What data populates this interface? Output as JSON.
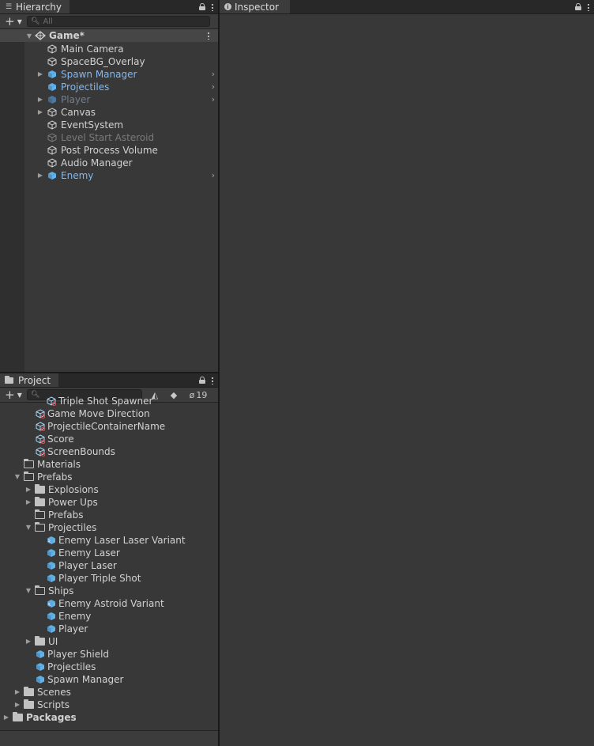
{
  "hierarchy": {
    "tab_label": "Hierarchy",
    "search_placeholder": "All",
    "scene_name": "Game*",
    "items": [
      {
        "label": "Main Camera",
        "style": "normal",
        "expander": false,
        "chevron": false,
        "icon": "gameobject-icon"
      },
      {
        "label": "SpaceBG_Overlay",
        "style": "normal",
        "expander": false,
        "chevron": false,
        "icon": "gameobject-icon"
      },
      {
        "label": "Spawn Manager",
        "style": "blue",
        "expander": true,
        "chevron": true,
        "icon": "prefab-icon"
      },
      {
        "label": "Projectiles",
        "style": "blue",
        "expander": false,
        "chevron": true,
        "icon": "prefab-icon"
      },
      {
        "label": "Player",
        "style": "dim",
        "expander": true,
        "chevron": true,
        "icon": "prefab-icon"
      },
      {
        "label": "Canvas",
        "style": "normal",
        "expander": true,
        "chevron": false,
        "icon": "gameobject-icon"
      },
      {
        "label": "EventSystem",
        "style": "normal",
        "expander": false,
        "chevron": false,
        "icon": "gameobject-icon"
      },
      {
        "label": "Level Start Asteroid",
        "style": "gray",
        "expander": false,
        "chevron": false,
        "icon": "gameobject-icon"
      },
      {
        "label": "Post Process Volume",
        "style": "normal",
        "expander": false,
        "chevron": false,
        "icon": "gameobject-icon"
      },
      {
        "label": "Audio Manager",
        "style": "normal",
        "expander": false,
        "chevron": false,
        "icon": "gameobject-icon"
      },
      {
        "label": "Enemy",
        "style": "blue",
        "expander": true,
        "chevron": true,
        "icon": "prefab-icon"
      }
    ]
  },
  "project": {
    "tab_label": "Project",
    "hidden_count": "19",
    "items": [
      {
        "label": "Triple Shot Spawner",
        "depth": 3,
        "kind": "scriptable",
        "arrow": "none"
      },
      {
        "label": "Game Move Direction",
        "depth": 2,
        "kind": "scriptable",
        "arrow": "none"
      },
      {
        "label": "ProjectileContainerName",
        "depth": 2,
        "kind": "scriptable",
        "arrow": "none"
      },
      {
        "label": "Score",
        "depth": 2,
        "kind": "scriptable",
        "arrow": "none"
      },
      {
        "label": "ScreenBounds",
        "depth": 2,
        "kind": "scriptable",
        "arrow": "none"
      },
      {
        "label": "Materials",
        "depth": 1,
        "kind": "folder-empty",
        "arrow": "none"
      },
      {
        "label": "Prefabs",
        "depth": 1,
        "kind": "folder-open",
        "arrow": "down"
      },
      {
        "label": "Explosions",
        "depth": 2,
        "kind": "folder",
        "arrow": "right"
      },
      {
        "label": "Power Ups",
        "depth": 2,
        "kind": "folder",
        "arrow": "right"
      },
      {
        "label": "Prefabs",
        "depth": 2,
        "kind": "folder-empty",
        "arrow": "none"
      },
      {
        "label": "Projectiles",
        "depth": 2,
        "kind": "folder-open",
        "arrow": "down"
      },
      {
        "label": "Enemy Laser Laser Variant",
        "depth": 3,
        "kind": "variant",
        "arrow": "none"
      },
      {
        "label": "Enemy Laser",
        "depth": 3,
        "kind": "prefab",
        "arrow": "none"
      },
      {
        "label": "Player Laser",
        "depth": 3,
        "kind": "prefab",
        "arrow": "none"
      },
      {
        "label": "Player Triple Shot",
        "depth": 3,
        "kind": "prefab",
        "arrow": "none"
      },
      {
        "label": "Ships",
        "depth": 2,
        "kind": "folder-open",
        "arrow": "down"
      },
      {
        "label": "Enemy Astroid Variant",
        "depth": 3,
        "kind": "variant",
        "arrow": "none"
      },
      {
        "label": "Enemy",
        "depth": 3,
        "kind": "prefab",
        "arrow": "none"
      },
      {
        "label": "Player",
        "depth": 3,
        "kind": "prefab",
        "arrow": "none"
      },
      {
        "label": "UI",
        "depth": 2,
        "kind": "folder",
        "arrow": "right"
      },
      {
        "label": "Player Shield",
        "depth": 2,
        "kind": "prefab",
        "arrow": "none"
      },
      {
        "label": "Projectiles",
        "depth": 2,
        "kind": "prefab",
        "arrow": "none"
      },
      {
        "label": "Spawn Manager",
        "depth": 2,
        "kind": "prefab",
        "arrow": "none"
      },
      {
        "label": "Scenes",
        "depth": 1,
        "kind": "folder",
        "arrow": "right"
      },
      {
        "label": "Scripts",
        "depth": 1,
        "kind": "folder",
        "arrow": "right"
      },
      {
        "label": "Packages",
        "depth": 0,
        "kind": "folder",
        "arrow": "right",
        "bold": true
      }
    ]
  },
  "inspector": {
    "tab_label": "Inspector"
  },
  "colors": {
    "prefab": "#5fb4f0",
    "prefab_dim": "#4a7aa5",
    "scriptable_badge": "#d9534f"
  }
}
